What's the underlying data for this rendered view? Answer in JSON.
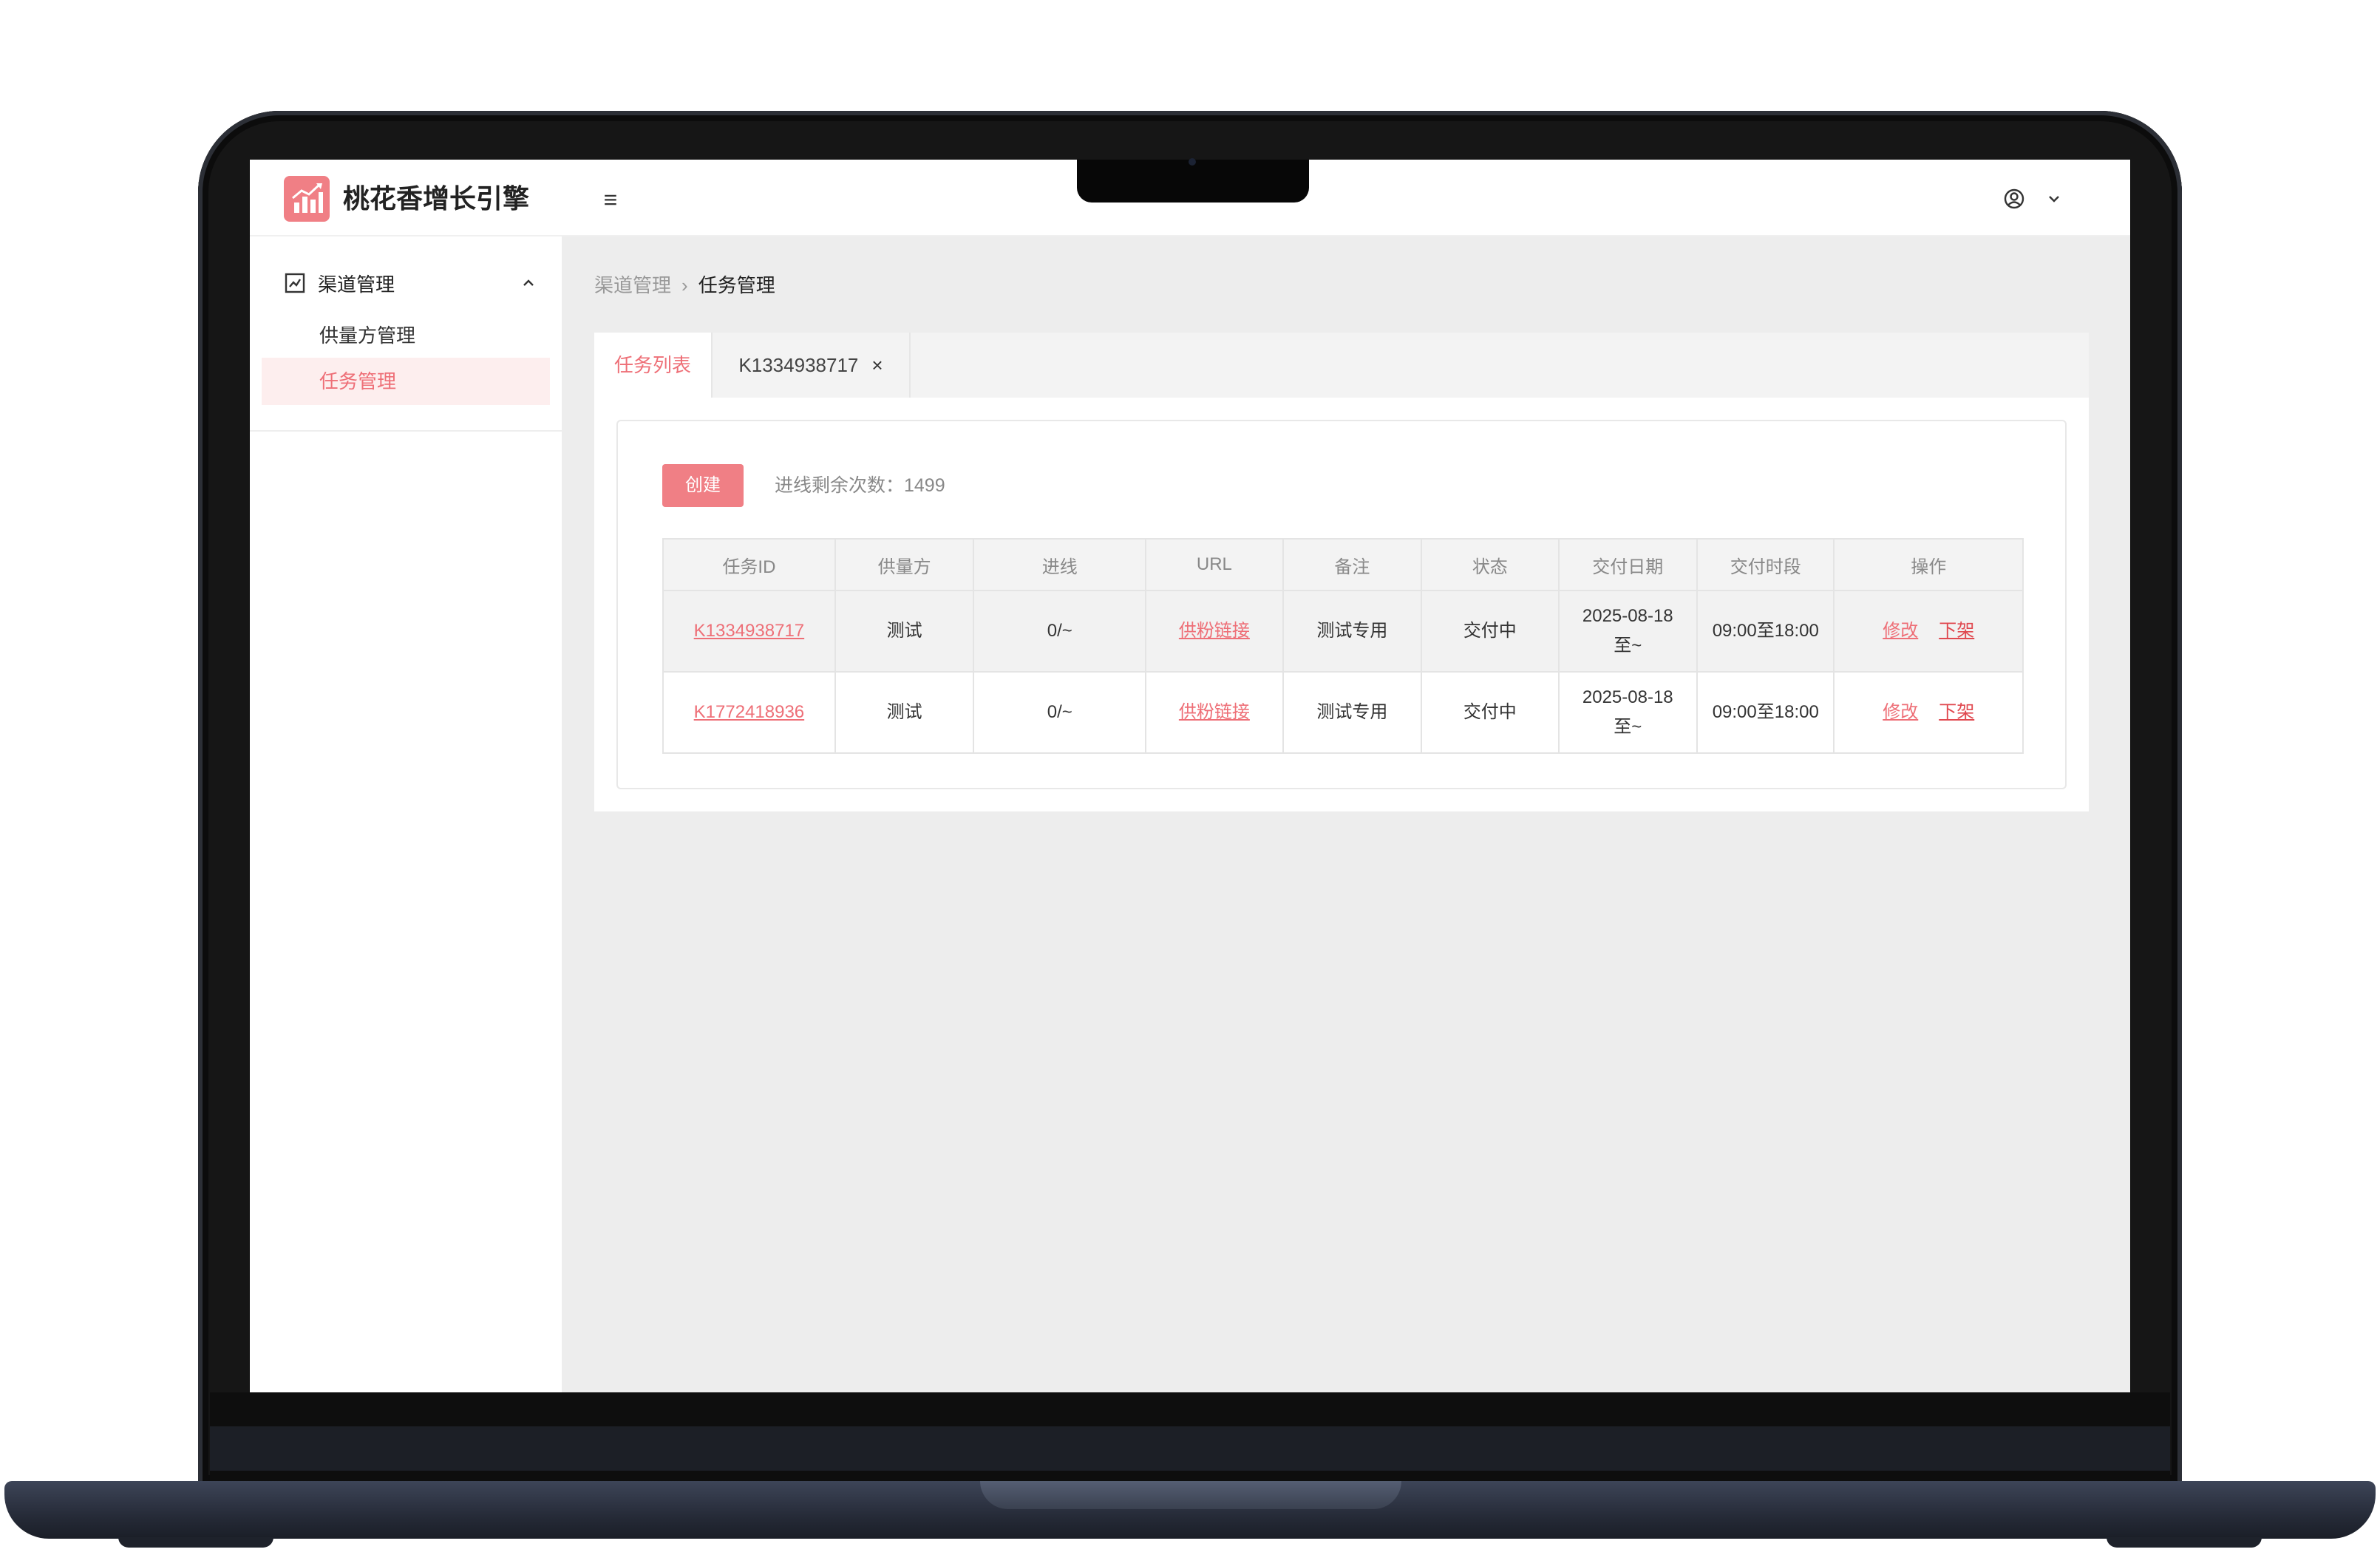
{
  "app": {
    "title": "桃花香增长引擎"
  },
  "header": {
    "menu_toggle": "≡"
  },
  "sidebar": {
    "group_label": "渠道管理",
    "items": [
      {
        "label": "供量方管理"
      },
      {
        "label": "任务管理"
      }
    ]
  },
  "breadcrumb": {
    "parent": "渠道管理",
    "separator": "›",
    "current": "任务管理"
  },
  "tabs": [
    {
      "label": "任务列表"
    },
    {
      "label": "K1334938717",
      "close": "×"
    }
  ],
  "toolbar": {
    "create_label": "创建",
    "remaining_text": "进线剩余次数：1499"
  },
  "table": {
    "columns": [
      "任务ID",
      "供量方",
      "进线",
      "URL",
      "备注",
      "状态",
      "交付日期",
      "交付时段",
      "操作"
    ],
    "rows": [
      {
        "task_id": "K1334938717",
        "supplier": "测试",
        "inbound": "0/~",
        "url": "供粉链接",
        "note": "测试专用",
        "status": "交付中",
        "date_line1": "2025-08-18",
        "date_line2": "至~",
        "period": "09:00至18:00",
        "edit": "修改",
        "offshelf": "下架"
      },
      {
        "task_id": "K1772418936",
        "supplier": "测试",
        "inbound": "0/~",
        "url": "供粉链接",
        "note": "测试专用",
        "status": "交付中",
        "date_line1": "2025-08-18",
        "date_line2": "至~",
        "period": "09:00至18:00",
        "edit": "修改",
        "offshelf": "下架"
      }
    ]
  },
  "colors": {
    "accent": "#f07f85",
    "accent_text": "#ee6f77",
    "danger_text": "#e0484f",
    "active_bg": "#fdeeee",
    "content_bg": "#ededed"
  }
}
